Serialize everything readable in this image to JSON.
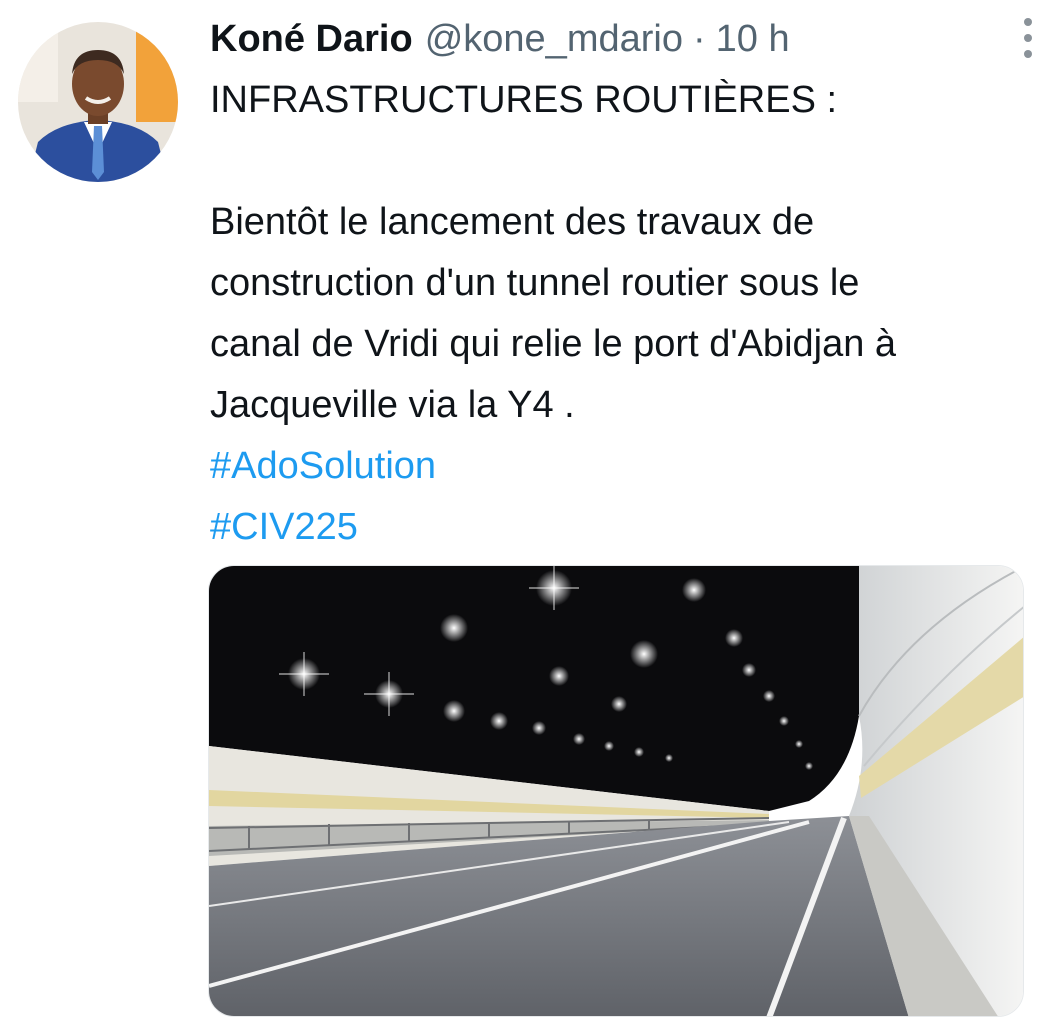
{
  "tweet": {
    "author_name": "Koné Dario",
    "author_handle": "@kone_mdario",
    "separator": "·",
    "timestamp": "10 h",
    "headline": "INFRASTRUCTURES ROUTIÈRES :",
    "body_lines": [
      "Bientôt le lancement des travaux de",
      "construction d'un tunnel routier sous le",
      "canal de Vridi qui relie le port d'Abidjan à",
      "Jacqueville via la Y4 ."
    ],
    "hashtags": [
      "#AdoSolution",
      "#CIV225"
    ],
    "colors": {
      "text": "#0f1419",
      "secondary": "#536471",
      "link": "#1d9bf0"
    },
    "icons": {
      "more": "more-vertical-icon"
    }
  }
}
